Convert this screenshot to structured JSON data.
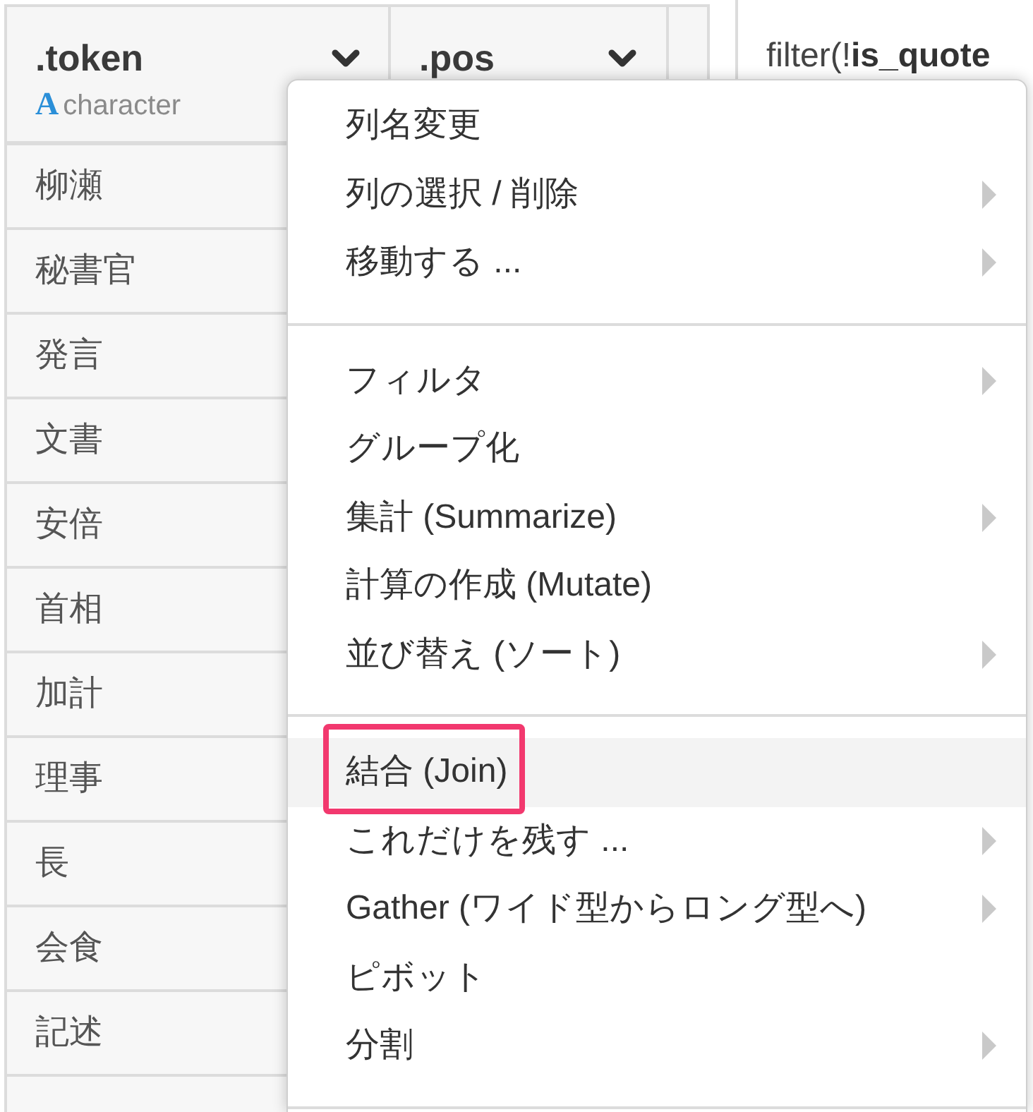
{
  "table": {
    "columns": [
      {
        "name": ".token",
        "type_icon": "A",
        "type": "character"
      },
      {
        "name": ".pos"
      }
    ],
    "rows": [
      [
        "柳瀬"
      ],
      [
        "秘書官"
      ],
      [
        "発言"
      ],
      [
        "文書"
      ],
      [
        "安倍"
      ],
      [
        "首相"
      ],
      [
        "加計"
      ],
      [
        "理事"
      ],
      [
        "長"
      ],
      [
        "会食"
      ],
      [
        "記述"
      ]
    ]
  },
  "step_pane": {
    "code": "filter(!**is_quote**"
  },
  "context_menu": {
    "groups": [
      {
        "items": [
          {
            "label": "列名変更",
            "submenu": false,
            "selected": false,
            "callout": false
          },
          {
            "label": "列の選択 / 削除",
            "submenu": true,
            "selected": false,
            "callout": false
          },
          {
            "label": "移動する ...",
            "submenu": true,
            "selected": false,
            "callout": false
          }
        ]
      },
      {
        "items": [
          {
            "label": "フィルタ",
            "submenu": true,
            "selected": false,
            "callout": false
          },
          {
            "label": "グループ化",
            "submenu": false,
            "selected": false,
            "callout": false
          },
          {
            "label": "集計 (Summarize)",
            "submenu": true,
            "selected": false,
            "callout": false
          },
          {
            "label": "計算の作成 (Mutate)",
            "submenu": false,
            "selected": false,
            "callout": false
          },
          {
            "label": "並び替え (ソート)",
            "submenu": true,
            "selected": false,
            "callout": false
          }
        ]
      },
      {
        "items": [
          {
            "label": "結合 (Join)",
            "submenu": false,
            "selected": true,
            "callout": true
          },
          {
            "label": "これだけを残す ...",
            "submenu": true,
            "selected": false,
            "callout": false
          },
          {
            "label": "Gather (ワイド型からロング型へ)",
            "submenu": true,
            "selected": false,
            "callout": false
          },
          {
            "label": "ピボット",
            "submenu": false,
            "selected": false,
            "callout": false
          },
          {
            "label": "分割",
            "submenu": true,
            "selected": false,
            "callout": false
          }
        ]
      }
    ]
  }
}
